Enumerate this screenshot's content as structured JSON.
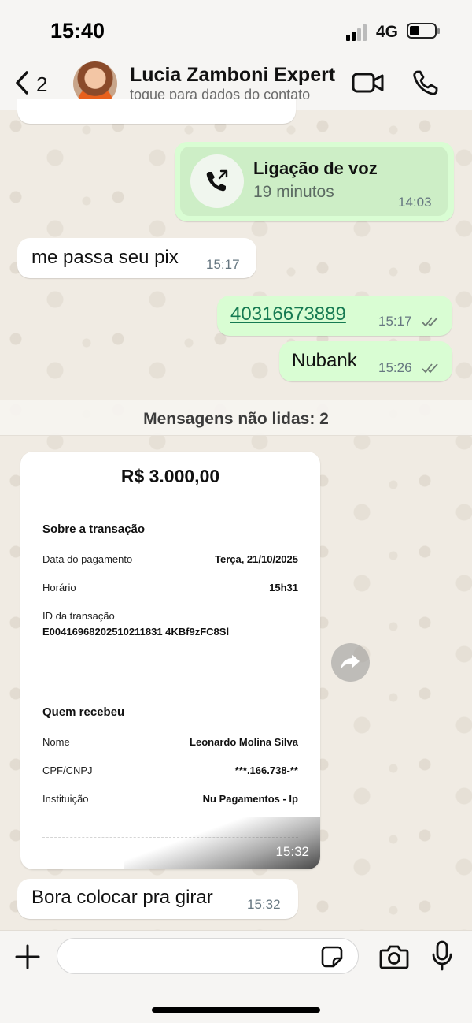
{
  "status_bar": {
    "time": "15:40",
    "network": "4G"
  },
  "header": {
    "back_count": "2",
    "contact_name": "Lucia Zamboni Expert",
    "contact_subtitle": "toque para dados do contato"
  },
  "messages": {
    "voice_call": {
      "title": "Ligação de voz",
      "duration": "19 minutos",
      "time": "14:03"
    },
    "msg1": {
      "text": "me passa seu pix",
      "time": "15:17"
    },
    "msg2": {
      "text": "40316673889",
      "time": "15:17"
    },
    "msg3": {
      "text": "Nubank",
      "time": "15:26"
    },
    "unread_label": "Mensagens não lidas: 2",
    "receipt": {
      "amount": "R$ 3.000,00",
      "section_transaction": "Sobre a transação",
      "date_label": "Data do pagamento",
      "date_value": "Terça, 21/10/2025",
      "time_label": "Horário",
      "time_value": "15h31",
      "id_label": "ID da transação",
      "id_value": "E00416968202510211831 4KBf9zFC8Sl",
      "section_receiver": "Quem recebeu",
      "name_label": "Nome",
      "name_value": "Leonardo Molina Silva",
      "doc_label": "CPF/CNPJ",
      "doc_value": "***.166.738-**",
      "inst_label": "Instituição",
      "inst_value": "Nu Pagamentos - Ip",
      "time": "15:32"
    },
    "msg4": {
      "text": "Bora colocar pra girar",
      "time": "15:32"
    }
  },
  "input": {
    "placeholder": "",
    "value": ""
  },
  "colors": {
    "outgoing": "#d9fdd3",
    "incoming": "#ffffff",
    "link": "#167a52"
  }
}
